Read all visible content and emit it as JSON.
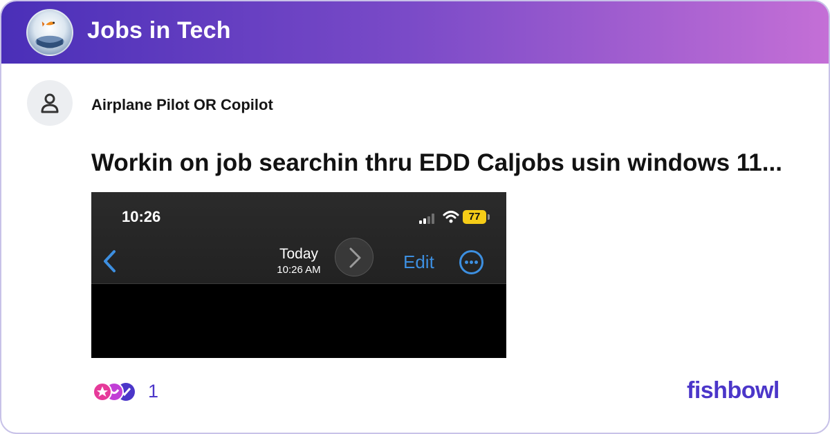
{
  "header": {
    "community_title": "Jobs in Tech",
    "logo_icon": "fishbowl-logo-icon"
  },
  "post": {
    "author": "Airplane Pilot OR Copilot",
    "title": "Workin on job searchin thru EDD Caljobs usin windows 11...",
    "avatar_icon": "person-icon"
  },
  "screenshot": {
    "status_time": "10:26",
    "battery": "77",
    "nav_title": "Today",
    "nav_subtitle": "10:26 AM",
    "edit_label": "Edit",
    "back_icon": "chevron-left-icon",
    "more_icon": "ellipsis-circle-icon"
  },
  "footer": {
    "reaction_count": "1",
    "brand": "fishbowl"
  },
  "colors": {
    "accent": "#4b36c9",
    "header_gradient_start": "#4a2fb8",
    "header_gradient_end": "#c46fd6",
    "ios_blue": "#3d8fe0",
    "battery_yellow": "#f5cc17"
  }
}
